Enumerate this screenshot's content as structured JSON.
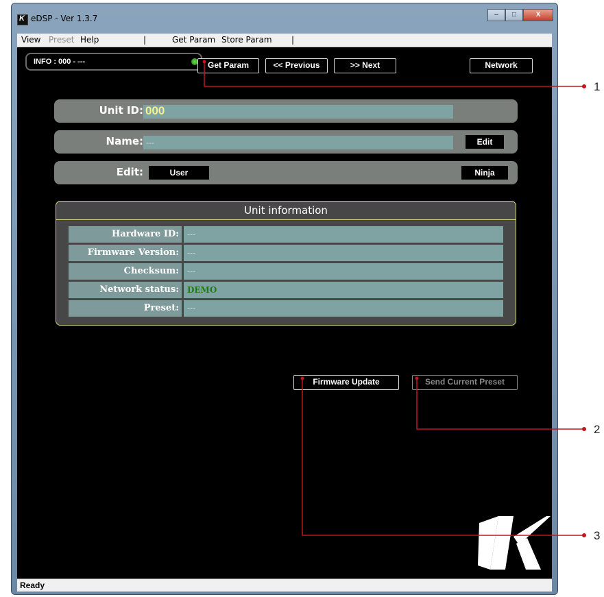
{
  "window": {
    "title": "eDSP - Ver 1.3.7",
    "controls": [
      "–",
      "□",
      "X"
    ]
  },
  "menu": {
    "items": [
      "View",
      "Preset",
      "Help",
      "|",
      "Get Param",
      "Store Param",
      "|"
    ]
  },
  "toolbar": {
    "info": "INFO : 000 -  ---",
    "get_param": "Get Param",
    "previous": "<< Previous",
    "next": ">> Next",
    "network": "Network"
  },
  "unit": {
    "id_label": "Unit ID:",
    "id_value": "000",
    "name_label": "Name:",
    "name_value": "---",
    "edit_button": "Edit",
    "edit_label": "Edit:",
    "user_button": "User",
    "ninja_button": "Ninja"
  },
  "info_panel": {
    "title": "Unit information",
    "rows": [
      {
        "label": "Hardware ID:",
        "value": "---"
      },
      {
        "label": "Firmware Version:",
        "value": "---"
      },
      {
        "label": "Checksum:",
        "value": "---"
      },
      {
        "label": "Network status:",
        "value": "DEMO"
      },
      {
        "label": "Preset:",
        "value": "---"
      }
    ]
  },
  "actions": {
    "firmware_update": "Firmware Update",
    "send_preset": "Send Current Preset"
  },
  "status": {
    "text": "Ready"
  },
  "callouts": [
    "1",
    "2",
    "3"
  ],
  "colors": {
    "accent_red": "#c0161f",
    "status_demo": "#1f7b16"
  }
}
